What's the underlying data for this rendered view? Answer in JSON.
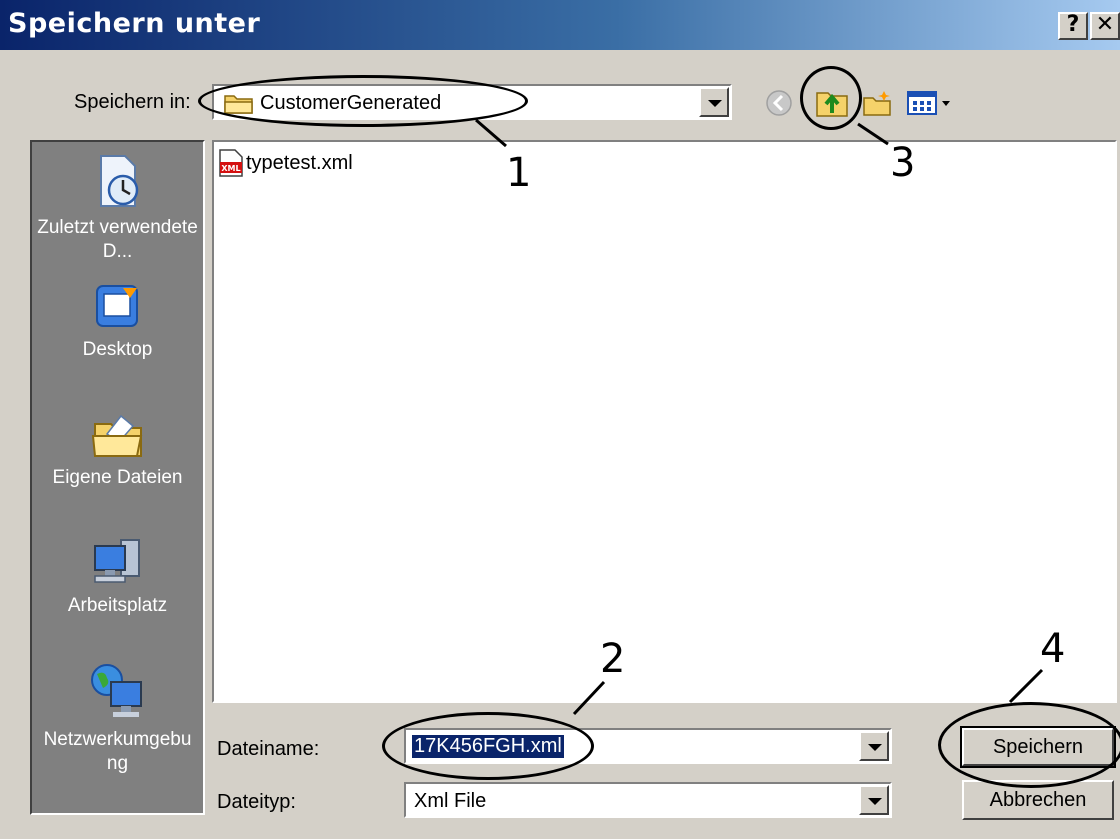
{
  "window": {
    "title": "Speichern unter",
    "help_btn": "?",
    "close_btn": "✕"
  },
  "toolbar": {
    "save_in_label": "Speichern in:",
    "current_folder": "CustomerGenerated",
    "back_icon": "back-arrow-icon",
    "up_icon": "up-folder-icon",
    "new_folder_icon": "new-folder-icon",
    "views_icon": "views-menu-icon"
  },
  "places": [
    {
      "label": "Zuletzt verwendete D...",
      "icon": "recent-documents-icon"
    },
    {
      "label": "Desktop",
      "icon": "desktop-icon"
    },
    {
      "label": "Eigene Dateien",
      "icon": "my-documents-icon"
    },
    {
      "label": "Arbeitsplatz",
      "icon": "my-computer-icon"
    },
    {
      "label": "Netzwerkumgebung",
      "icon": "network-icon"
    }
  ],
  "files": [
    {
      "name": "typetest.xml",
      "icon": "xml-file-icon"
    }
  ],
  "filename": {
    "label": "Dateiname:",
    "value": "17K456FGH.xml"
  },
  "filetype": {
    "label": "Dateityp:",
    "value": "Xml File"
  },
  "buttons": {
    "save": "Speichern",
    "cancel": "Abbrechen"
  },
  "annotations": [
    "1",
    "2",
    "3",
    "4"
  ],
  "colors": {
    "titlebar_start": "#0a246a",
    "titlebar_end": "#a6caf0",
    "selection": "#0a246a"
  }
}
